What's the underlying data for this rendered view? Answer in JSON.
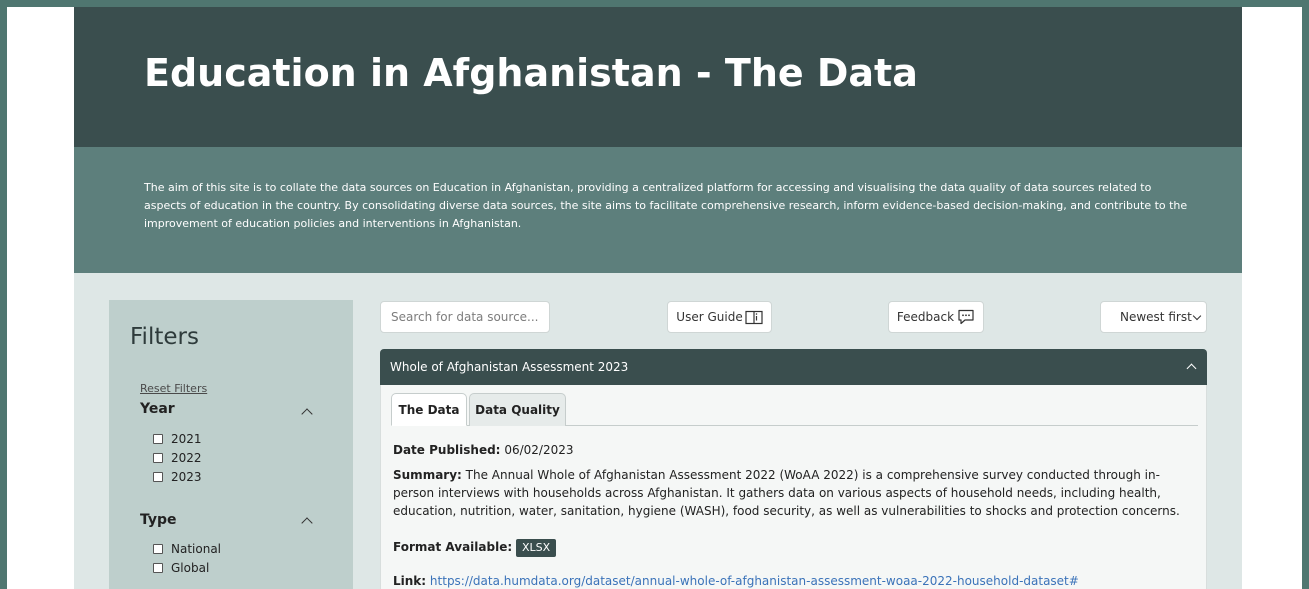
{
  "header": {
    "title": "Education in Afghanistan - The Data",
    "intro": "The aim of this site is to collate the data sources on Education in Afghanistan, providing a centralized platform for accessing and visualising the data quality of data sources related to aspects of education in the country. By consolidating diverse data sources, the site aims to facilitate comprehensive research, inform evidence-based decision-making, and contribute to the improvement of education policies and interventions in Afghanistan."
  },
  "filters": {
    "title": "Filters",
    "reset_label": "Reset Filters",
    "groups": [
      {
        "title": "Year",
        "options": [
          "2021",
          "2022",
          "2023"
        ]
      },
      {
        "title": "Type",
        "options": [
          "National",
          "Global"
        ]
      }
    ]
  },
  "toolbar": {
    "search_placeholder": "Search for data source...",
    "user_guide_label": "User Guide",
    "feedback_label": "Feedback",
    "sort_selected": "Newest first"
  },
  "dataset": {
    "title": "Whole of Afghanistan Assessment 2023",
    "tabs": [
      "The Data",
      "Data Quality"
    ],
    "date_label": "Date Published:",
    "date_value": "06/02/2023",
    "summary_label": "Summary:",
    "summary_value": "The Annual Whole of Afghanistan Assessment 2022 (WoAA 2022) is a comprehensive survey conducted through in-person interviews with households across Afghanistan. It gathers data on various aspects of household needs, including health, education, nutrition, water, sanitation, hygiene (WASH), food security, as well as vulnerabilities to shocks and protection concerns.",
    "format_label": "Format Available:",
    "format_value": "XLSX",
    "link_label": "Link:",
    "link_value": "https://data.humdata.org/dataset/annual-whole-of-afghanistan-assessment-woaa-2022-household-dataset#"
  },
  "icons": {
    "user_guide": "book-icon",
    "feedback": "chat-bubble-icon",
    "sort": "chevron-down-icon",
    "collapse": "chevron-up-icon"
  },
  "colors": {
    "banner": "#3a4e4e",
    "intro": "#5d7f7c",
    "panel": "#becfcc",
    "accent": "#3a4e4e",
    "link": "#3b73b9"
  }
}
